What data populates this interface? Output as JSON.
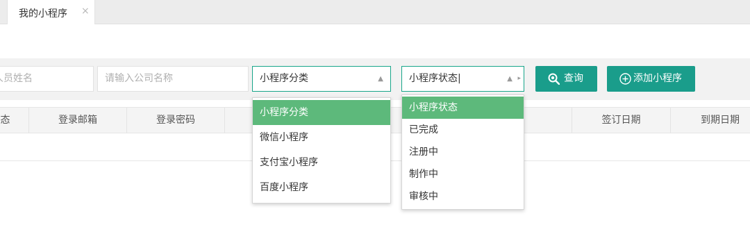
{
  "tabs": [
    {
      "label": "我的小程序",
      "close_glyph": "×"
    }
  ],
  "filters": {
    "member_name_placeholder": "人员姓名",
    "company_placeholder": "请输入公司名称",
    "category_value": "小程序分类",
    "status_value": "小程序状态"
  },
  "buttons": {
    "search_label": "查询",
    "search_icon": "search-icon",
    "add_label": "添加小程序",
    "add_icon": "plus-circle-icon"
  },
  "table": {
    "columns": [
      "状态",
      "登录邮箱",
      "登录密码",
      "",
      "签订日期",
      "到期日期"
    ]
  },
  "category_dropdown": {
    "options": [
      "小程序分类",
      "微信小程序",
      "支付宝小程序",
      "百度小程序"
    ],
    "selected_index": 0
  },
  "status_dropdown": {
    "options": [
      "小程序状态",
      "已完成",
      "注册中",
      "制作中",
      "审核中"
    ],
    "selected_index": 0
  },
  "colors": {
    "accent": "#1a9d8b",
    "select_border": "#17a589",
    "selected_option": "#5db97b"
  }
}
